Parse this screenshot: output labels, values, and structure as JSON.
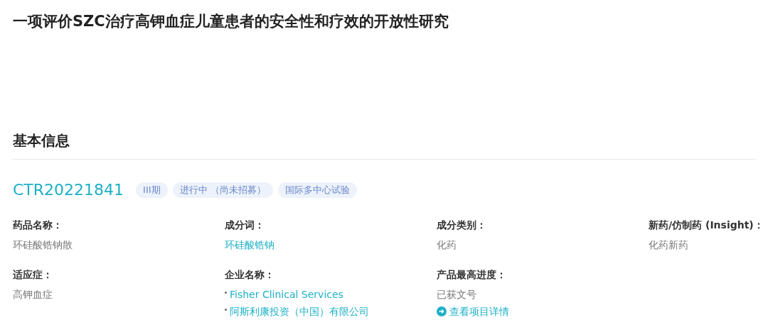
{
  "title": "一项评价SZC治疗高钾血症儿童患者的安全性和疗效的开放性研究",
  "section": {
    "heading": "基本信息"
  },
  "trial": {
    "id": "CTR20221841",
    "tags": [
      "III期",
      "进行中 （尚未招募）",
      "国际多中心试验"
    ]
  },
  "fields": [
    {
      "label": "药品名称：",
      "items": [
        {
          "kind": "text",
          "text": "环硅酸锆钠散"
        }
      ]
    },
    {
      "label": "成分词：",
      "items": [
        {
          "kind": "link",
          "text": "环硅酸锆钠"
        }
      ]
    },
    {
      "label": "成分类别：",
      "items": [
        {
          "kind": "text",
          "text": "化药"
        }
      ]
    },
    {
      "label": "新药/仿制药 (Insight)：",
      "items": [
        {
          "kind": "text",
          "text": "化药新药"
        }
      ]
    },
    {
      "label": "适应症：",
      "items": [
        {
          "kind": "text",
          "text": "高钾血症"
        }
      ]
    },
    {
      "label": "企业名称：",
      "items": [
        {
          "kind": "bullet_link",
          "text": "Fisher Clinical Services"
        },
        {
          "kind": "bullet_link",
          "text": "阿斯利康投资（中国）有限公司"
        }
      ]
    },
    {
      "label": "产品最高进度：",
      "items": [
        {
          "kind": "text",
          "text": "已获文号"
        },
        {
          "kind": "action_link",
          "text": "查看项目详情"
        }
      ]
    }
  ]
}
